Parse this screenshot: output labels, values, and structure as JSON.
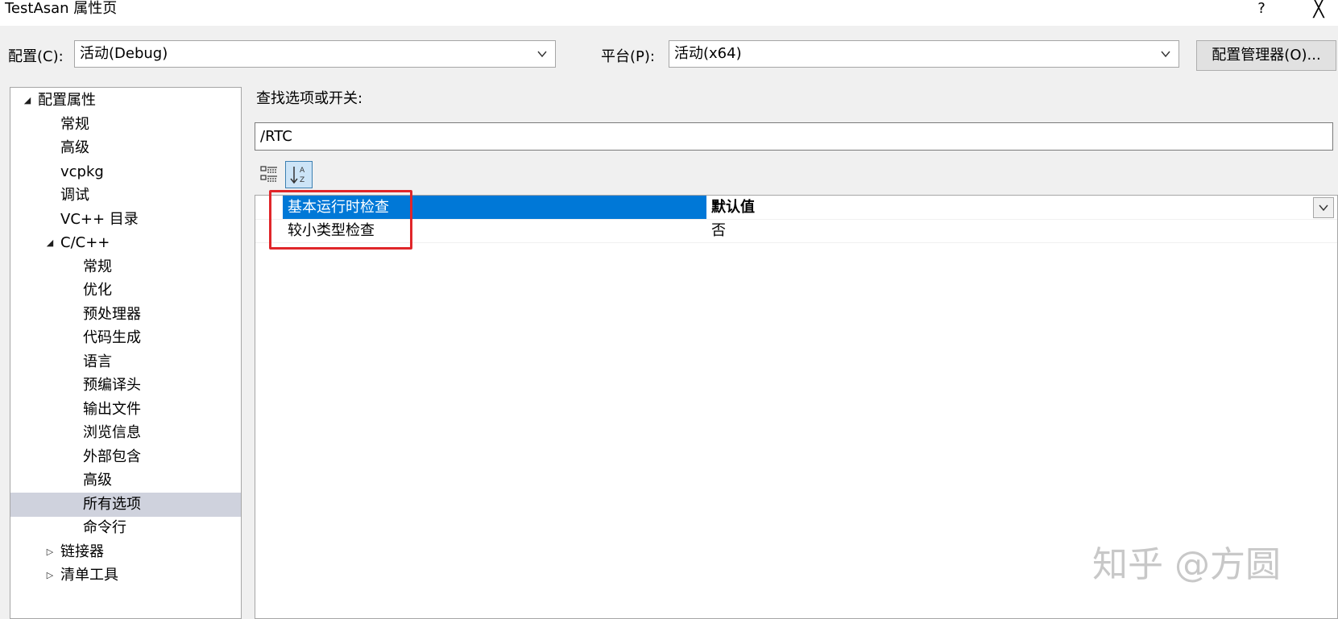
{
  "window": {
    "title": "TestAsan 属性页",
    "help_label": "?",
    "close_label": "╳"
  },
  "config": {
    "label": "配置(C):",
    "value": "活动(Debug)"
  },
  "platform": {
    "label": "平台(P):",
    "value": "活动(x64)"
  },
  "manager_button": "配置管理器(O)...",
  "tree": {
    "items": [
      {
        "label": "配置属性",
        "toggle": "◢"
      },
      {
        "label": "常规"
      },
      {
        "label": "高级"
      },
      {
        "label": "vcpkg"
      },
      {
        "label": "调试"
      },
      {
        "label": "VC++ 目录"
      },
      {
        "label": "C/C++",
        "toggle": "◢"
      },
      {
        "label": "常规"
      },
      {
        "label": "优化"
      },
      {
        "label": "预处理器"
      },
      {
        "label": "代码生成"
      },
      {
        "label": "语言"
      },
      {
        "label": "预编译头"
      },
      {
        "label": "输出文件"
      },
      {
        "label": "浏览信息"
      },
      {
        "label": "外部包含"
      },
      {
        "label": "高级"
      },
      {
        "label": "所有选项",
        "selected": true
      },
      {
        "label": "命令行"
      },
      {
        "label": "链接器",
        "toggle": "▷"
      },
      {
        "label": "清单工具",
        "toggle": "▷"
      }
    ]
  },
  "search": {
    "label": "查找选项或开关:",
    "value": "/RTC"
  },
  "toolbar": {
    "categorized_icon": "categorized-icon",
    "alphabetical_icon": "sort-alphabetical-icon"
  },
  "grid": {
    "rows": [
      {
        "name": "基本运行时检查",
        "value": "默认值",
        "selected": true
      },
      {
        "name": "较小类型检查",
        "value": "否"
      }
    ]
  },
  "colors": {
    "selection": "#0078d7",
    "highlight_box": "#e0262a",
    "tree_selected": "#cfd2dd"
  },
  "watermark": "知乎 @方圆"
}
